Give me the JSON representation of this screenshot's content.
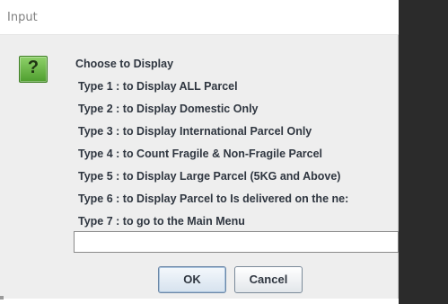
{
  "window": {
    "title": "Input"
  },
  "icon": {
    "name": "question-icon",
    "glyph": "?"
  },
  "message": {
    "lines": [
      "Choose to Display",
      "Type 1 : to Display ALL Parcel",
      "Type 2 : to Display Domestic Only",
      "Type 3 : to Display International Parcel Only",
      "Type 4 : to Count Fragile & Non-Fragile Parcel",
      "Type 5 : to Display Large Parcel (5KG and Above)",
      "Type 6 : to Display Parcel to Is delivered on the ne:",
      "Type 7 : to go to the Main Menu"
    ]
  },
  "input": {
    "value": ""
  },
  "buttons": {
    "ok_label": "OK",
    "cancel_label": "Cancel"
  },
  "colors": {
    "dialog_bg": "#eeeeee",
    "text": "#2f3640",
    "icon_green": "#4e9e2e",
    "backdrop_dark": "#2b2b2b"
  }
}
